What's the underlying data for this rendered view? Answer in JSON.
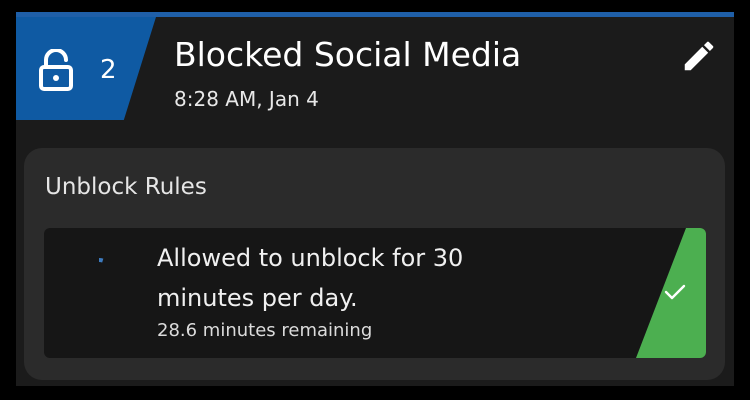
{
  "header": {
    "lock_count": "2",
    "title": "Blocked Social Media",
    "subtitle": "8:28 AM, Jan 4",
    "lock_icon": "lock-open-icon",
    "edit_icon": "pencil-icon",
    "badge_color": "#0f5aa3"
  },
  "rules": {
    "heading": "Unblock Rules",
    "items": [
      {
        "text": "Allowed to unblock for 30 minutes per day.",
        "remaining": "28.6 minutes remaining",
        "used_fraction": 0.047,
        "status_icon": "checkmark-icon",
        "status_color": "#4caf50"
      }
    ]
  }
}
